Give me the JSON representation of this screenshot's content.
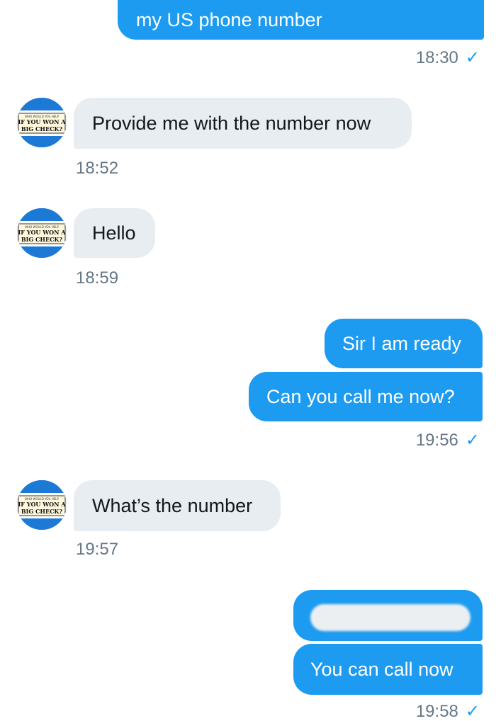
{
  "conversation": {
    "messages": [
      {
        "id": "m1",
        "direction": "outgoing",
        "text": "my US phone number"
      },
      {
        "id": "m2",
        "direction": "incoming",
        "text": "Provide me with the number now"
      },
      {
        "id": "m3",
        "direction": "incoming",
        "text": "Hello"
      },
      {
        "id": "m4",
        "direction": "outgoing",
        "text": "Sir I am ready"
      },
      {
        "id": "m5",
        "direction": "outgoing",
        "text": "Can you call me now?"
      },
      {
        "id": "m6",
        "direction": "incoming",
        "text": "What’s the number"
      },
      {
        "id": "m7",
        "direction": "outgoing",
        "text": "",
        "redacted": true
      },
      {
        "id": "m8",
        "direction": "outgoing",
        "text": "You can call now"
      }
    ],
    "timestamps": [
      "18:30",
      "18:52",
      "18:59",
      "19:56",
      "19:57",
      "19:58"
    ],
    "read_check": "✓"
  },
  "contact": {
    "avatar_text_small": "WHO WOULD YOU HELP",
    "avatar_text_line1": "IF YOU WON A",
    "avatar_text_line2": "BIG CHECK?"
  },
  "theme": {
    "outgoing_bg": "#1d9bf0",
    "incoming_bg": "#e8edf2",
    "timestamp_color": "#657786",
    "check_color": "#1d9bf0"
  },
  "icons": {
    "read_receipt": "checkmark-icon",
    "contact_avatar": "avatar-check-logo"
  }
}
